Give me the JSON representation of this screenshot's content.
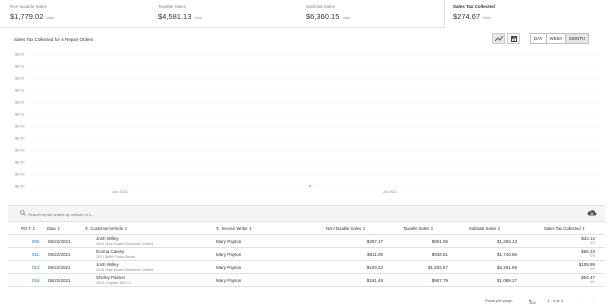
{
  "cards": [
    {
      "label": "Non-taxable Sales",
      "value": "$1,779.02",
      "unit": "total"
    },
    {
      "label": "Taxable Sales",
      "value": "$4,581.13",
      "unit": "total"
    },
    {
      "label": "Subtotal Sales",
      "value": "$6,360.15",
      "unit": "total"
    },
    {
      "label": "Sales Tax Collected",
      "value": "$274.67",
      "unit": "total"
    }
  ],
  "chart_header": {
    "title": "Sales Tax Collected for 4 Repair Orders",
    "ranges": [
      "DAY",
      "WEEK",
      "MONTH"
    ],
    "active_range": "MONTH"
  },
  "chart_data": {
    "type": "line",
    "title": "Sales Tax Collected for 4 Repair Orders",
    "y_ticks": [
      "$0.01",
      "$0.01",
      "$0.01",
      "$0.01",
      "$0.01",
      "$0.01",
      "$0.00",
      "$0.00",
      "$0.00",
      "$0.00",
      "$0.00",
      "$0.00"
    ],
    "x_ticks": [
      "Jun 2021",
      "Jul 2021"
    ],
    "points": [
      {
        "x": "Jun 2021",
        "y": 0.0
      }
    ],
    "grid": true
  },
  "table": {
    "search_placeholder": "Search repair orders by vehicle or c...",
    "headers": {
      "ro": "RO #",
      "date": "Date",
      "customer": "Customer/Vehicle",
      "writer": "Service Writer",
      "nontax": "Non-Taxable Sales",
      "taxable": "Taxable Sales",
      "subtotal": "Subtotal Sales",
      "tax": "Sales Tax Collected"
    },
    "rows": [
      {
        "ro": "002",
        "date": "06/22/2021",
        "customer": "Josh Willey",
        "vehicle": "2016 Jeep Grand Cherokee Limited",
        "writer": "Mary Payton",
        "nontax": "$357.17",
        "taxable": "$901.96",
        "subtotal": "$1,259.13",
        "tax": "$34.12",
        "tax_pct": "6%"
      },
      {
        "ro": "011",
        "date": "06/22/2021",
        "customer": "Donna Caisey",
        "vehicle": "2017 BMW Turbo Diesel",
        "writer": "Mary Payton",
        "nontax": "$811.05",
        "taxable": "$938.81",
        "subtotal": "$1,749.86",
        "tax": "$56.33",
        "tax_pct": "6%"
      },
      {
        "ro": "012",
        "date": "06/22/2021",
        "customer": "Josh Willey",
        "vehicle": "2016 Jeep Grand Cherokee Limited",
        "writer": "Mary Payton",
        "nontax": "$429.22",
        "taxable": "$1,832.57",
        "subtotal": "$2,261.69",
        "tax": "$109.95",
        "tax_pct": "6%"
      },
      {
        "ro": "016",
        "date": "06/22/2021",
        "customer": "Shirley Palmer",
        "vehicle": "2012 Chrysler 300 LX",
        "writer": "Mary Payton",
        "nontax": "$181.48",
        "taxable": "$907.79",
        "subtotal": "$1,089.27",
        "tax": "$54.47",
        "tax_pct": "6%"
      }
    ],
    "footer": {
      "rows_label": "Rows per page:",
      "rows_value": "100",
      "range": "1 - 4 of 4"
    }
  },
  "colors": {
    "link": "#1a6fc9",
    "grid": "#eeeeee",
    "point": "#5cb85c"
  }
}
